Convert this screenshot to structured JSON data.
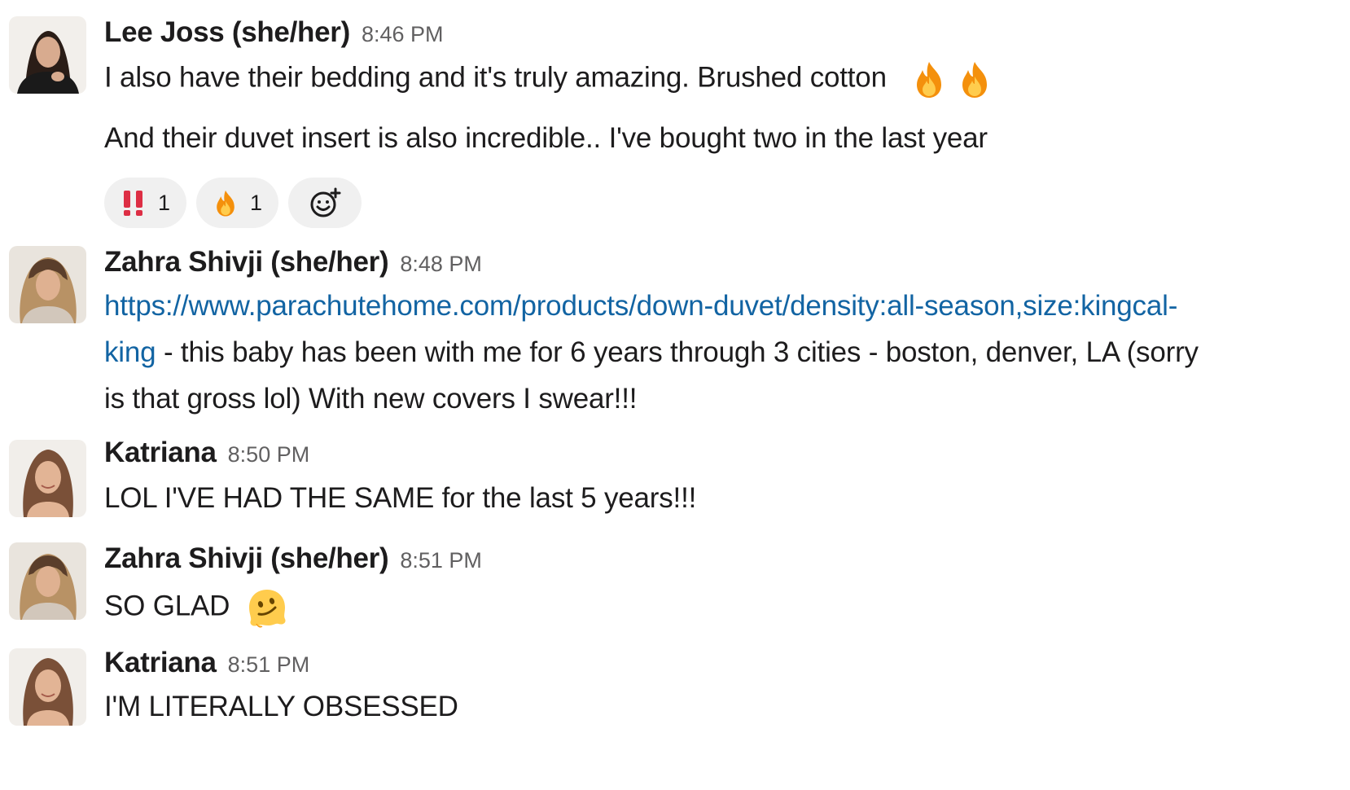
{
  "messages": [
    {
      "author": "Lee Joss (she/her)",
      "time": "8:46 PM",
      "avatar": "avatar-lee-joss",
      "lines": [
        "I also have their bedding and it's truly amazing. Brushed cotton",
        "And their duvet insert is also incredible.. I've bought two in the last year"
      ],
      "inline_emoji": [
        "fire-emoji",
        "fire-emoji"
      ],
      "reactions": [
        {
          "emoji": "double-exclamation-icon",
          "count": "1"
        },
        {
          "emoji": "fire-icon",
          "count": "1"
        },
        {
          "emoji": "add-reaction-icon",
          "count": ""
        }
      ]
    },
    {
      "author": "Zahra Shivji (she/her)",
      "time": "8:48 PM",
      "avatar": "avatar-zahra-shivji",
      "link_line1": "https://www.parachutehome.com/products/down-duvet/density:all-season,size:kingcal-",
      "link_line2": "king",
      "text_line2": " - this baby has been with me for 6 years through 3 cities - boston, denver, LA (sorry",
      "text_line3": "is that gross lol) With new covers I swear!!!"
    },
    {
      "author": "Katriana",
      "time": "8:50 PM",
      "avatar": "avatar-katriana",
      "text": "LOL I'VE HAD THE SAME for the last 5 years!!!"
    },
    {
      "author": "Zahra Shivji (she/her)",
      "time": "8:51 PM",
      "avatar": "avatar-zahra-shivji",
      "text": "SO GLAD",
      "inline_emoji": [
        "melting-face-emoji"
      ]
    },
    {
      "author": "Katriana",
      "time": "8:51 PM",
      "avatar": "avatar-katriana",
      "text": "I'M LITERALLY OBSESSED"
    }
  ],
  "colors": {
    "link": "#1264a3",
    "text": "#1d1c1d",
    "timestamp": "#616061",
    "reaction_bg": "#f0f0f0"
  }
}
